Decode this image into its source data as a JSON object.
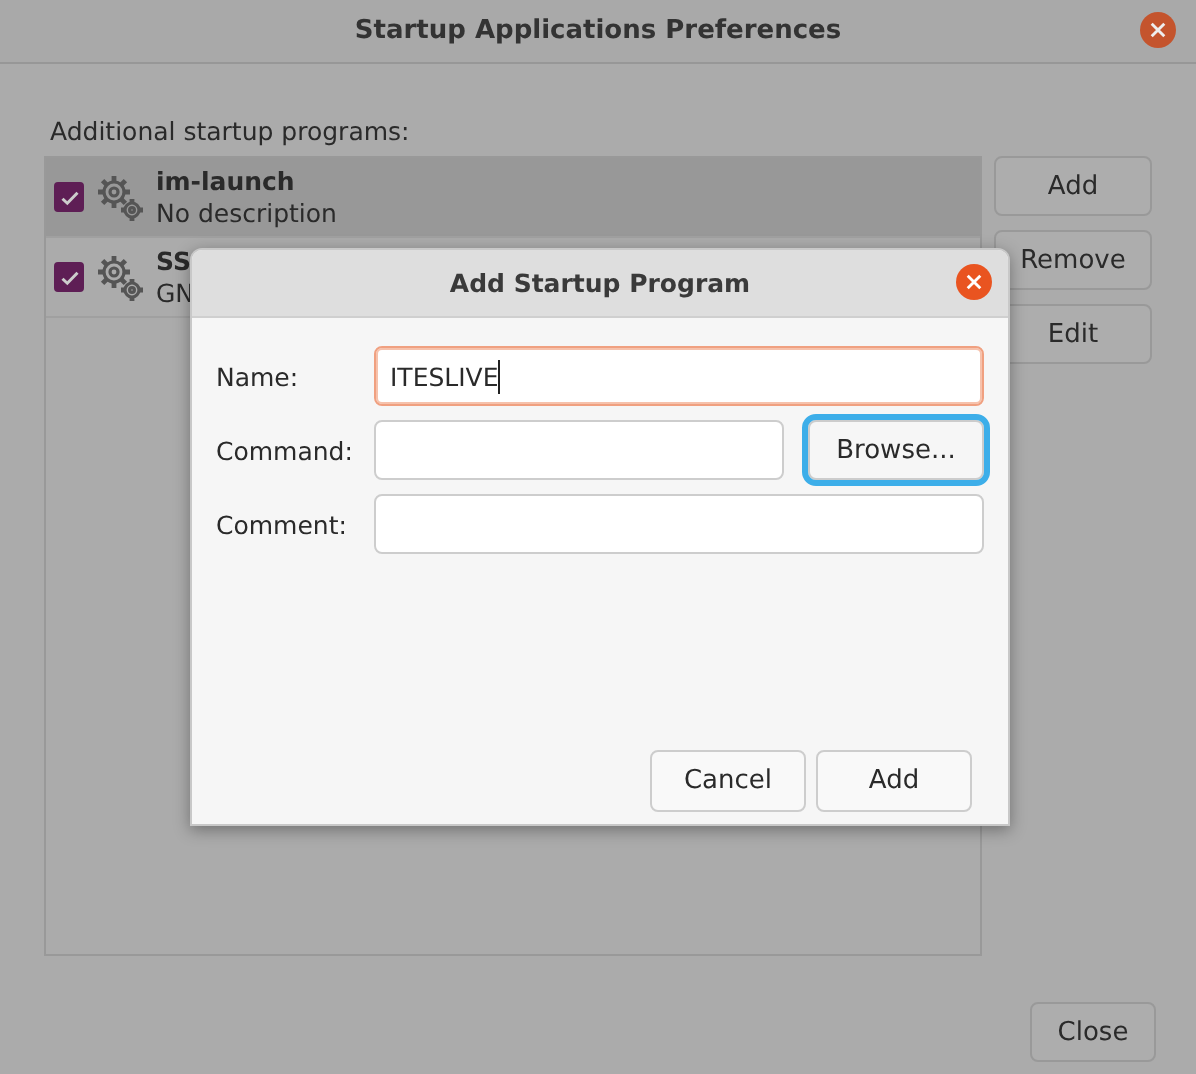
{
  "window": {
    "title": "Startup Applications Preferences"
  },
  "list_label": "Additional startup programs:",
  "programs": [
    {
      "name": "im-launch",
      "description": "No description",
      "checked": true,
      "selected": true
    },
    {
      "name": "SS",
      "description": "GN",
      "checked": true,
      "selected": false
    }
  ],
  "side_buttons": [
    "Add",
    "Remove",
    "Edit"
  ],
  "close_button": "Close",
  "dialog": {
    "title": "Add Startup Program",
    "fields": [
      {
        "label": "Name:",
        "value": "ITESLIVE",
        "focused": true
      },
      {
        "label": "Command:",
        "focused": false,
        "browse": {
          "label": "Browse...",
          "highlighted": true
        }
      },
      {
        "label": "Comment:",
        "focused": false
      }
    ],
    "buttons": [
      "Cancel",
      "Add"
    ]
  }
}
